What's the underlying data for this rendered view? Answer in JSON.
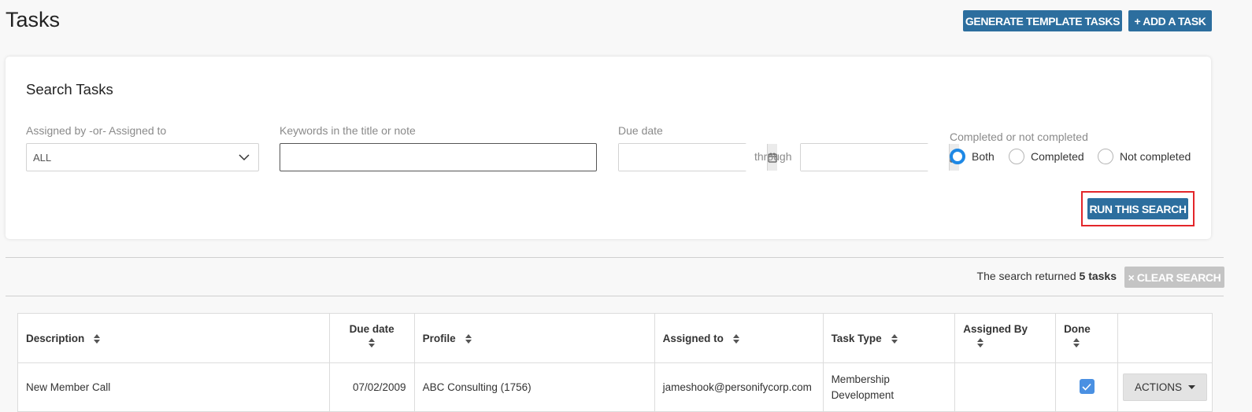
{
  "page": {
    "title": "Tasks"
  },
  "header_buttons": {
    "generate": "GENERATE TEMPLATE TASKS",
    "add": "+ ADD A TASK"
  },
  "search": {
    "title": "Search Tasks",
    "assigned_label": "Assigned by -or- Assigned to",
    "assigned_value": "ALL",
    "keywords_label": "Keywords in the title or note",
    "keywords_value": "",
    "due_label": "Due date",
    "through": "through",
    "completed_label": "Completed or not completed",
    "radios": [
      {
        "label": "Both",
        "checked": true
      },
      {
        "label": "Completed",
        "checked": false
      },
      {
        "label": "Not completed",
        "checked": false
      }
    ],
    "run_button": "RUN THIS SEARCH"
  },
  "results": {
    "prefix": "The search returned",
    "count": "5 tasks",
    "clear_button": "× CLEAR SEARCH"
  },
  "table": {
    "columns": [
      "Description",
      "Due date",
      "Profile",
      "Assigned to",
      "Task Type",
      "Assigned By",
      "Done",
      ""
    ],
    "rows": [
      {
        "description": "New Member Call",
        "due": "07/02/2009",
        "profile": "ABC Consulting (1756)",
        "assigned_to": "jameshook@personifycorp.com",
        "task_type": "Membership Development",
        "assigned_by": "",
        "done": true,
        "actions": "ACTIONS"
      }
    ]
  },
  "colors": {
    "primary": "#2c6e9e",
    "highlight": "#e3262a",
    "radio": "#1e88e5",
    "check": "#4a90e2"
  }
}
